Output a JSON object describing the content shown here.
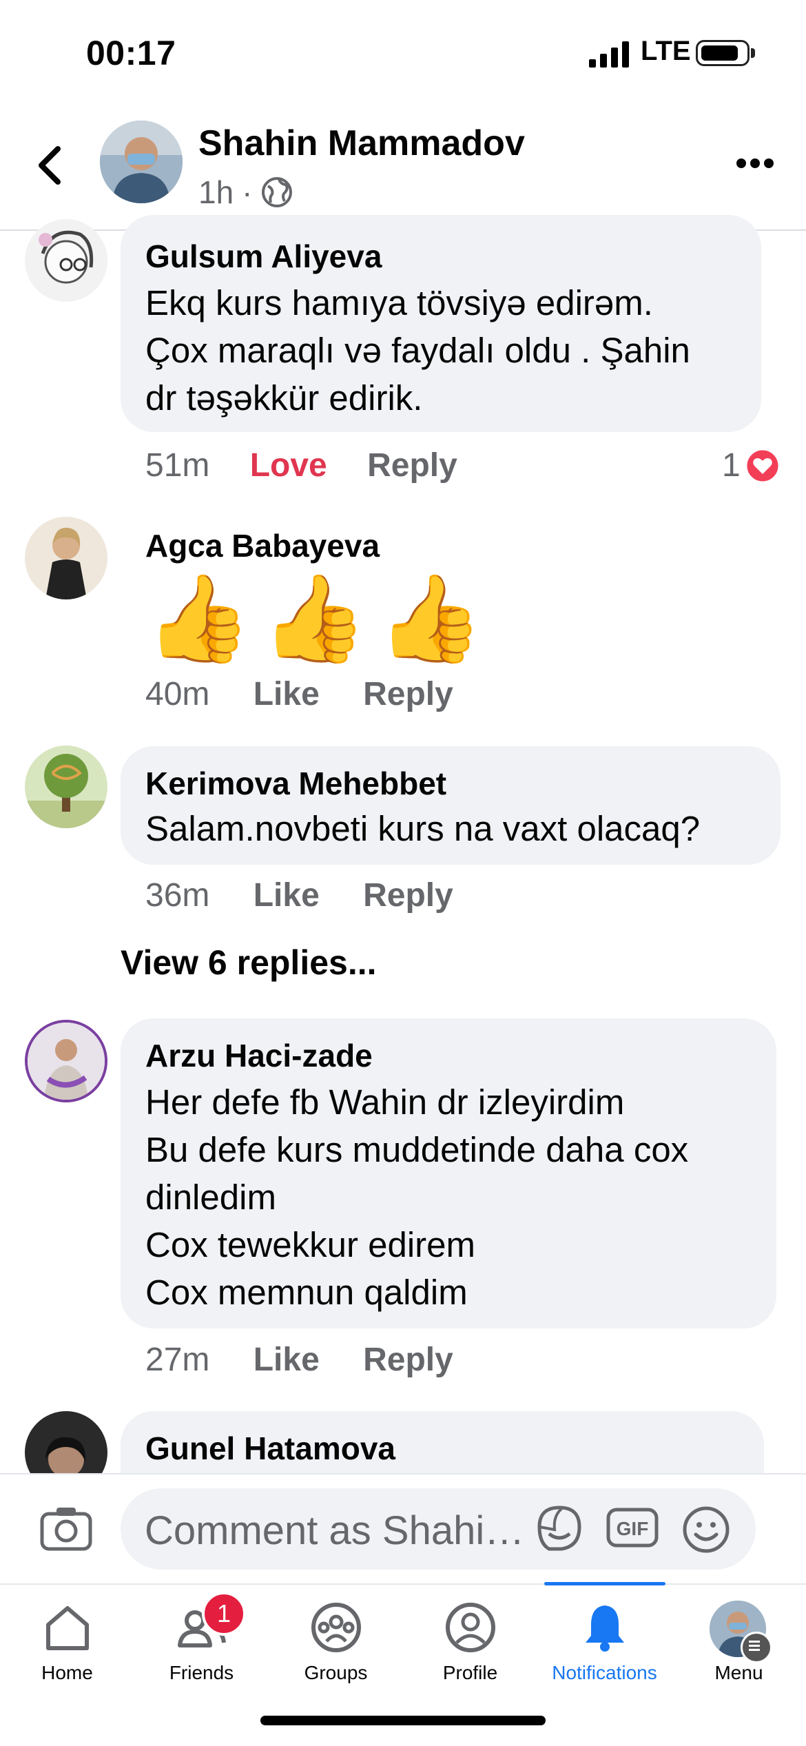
{
  "status_bar": {
    "time": "00:17",
    "network": "LTE"
  },
  "header": {
    "name": "Shahin Mammadov",
    "age": "1h",
    "separator": "·"
  },
  "comments": [
    {
      "name": "Gulsum Aliyeva",
      "text": "Ekq kurs hamıya tövsiyə edirəm.\nÇox maraqlı və faydalı oldu . Şahin\ndr təşəkkür edirik.",
      "time": "51m",
      "reaction_label": "Love",
      "reply_label": "Reply",
      "reaction_count": "1"
    },
    {
      "name": "Agca Babayeva",
      "emojis": [
        "👍",
        "👍",
        "👍"
      ],
      "time": "40m",
      "reaction_label": "Like",
      "reply_label": "Reply"
    },
    {
      "name": "Kerimova Mehebbet",
      "text": "Salam.novbeti kurs na vaxt olacaq?",
      "time": "36m",
      "reaction_label": "Like",
      "reply_label": "Reply"
    },
    {
      "name": "Arzu Haci-zade",
      "text": "Her defe fb Wahin dr izleyirdim\nBu defe kurs muddetinde daha cox\ndinledim\nCox tewekkur edirem\nCox memnun qaldim",
      "time": "27m",
      "reaction_label": "Like",
      "reply_label": "Reply"
    },
    {
      "name": "Gunel Hatamova"
    }
  ],
  "view_replies": "View 6 replies...",
  "composer": {
    "placeholder": "Comment as Shahi…"
  },
  "tabs": [
    {
      "label": "Home",
      "icon": "home-icon"
    },
    {
      "label": "Friends",
      "icon": "friends-icon",
      "badge": "1"
    },
    {
      "label": "Groups",
      "icon": "groups-icon"
    },
    {
      "label": "Profile",
      "icon": "profile-icon"
    },
    {
      "label": "Notifications",
      "icon": "bell-icon",
      "active": true
    },
    {
      "label": "Menu",
      "icon": "menu-avatar"
    }
  ],
  "colors": {
    "accent": "#1877f2",
    "love": "#e0364f",
    "badge": "#e41e3f",
    "bubble": "#f0f2f5"
  }
}
